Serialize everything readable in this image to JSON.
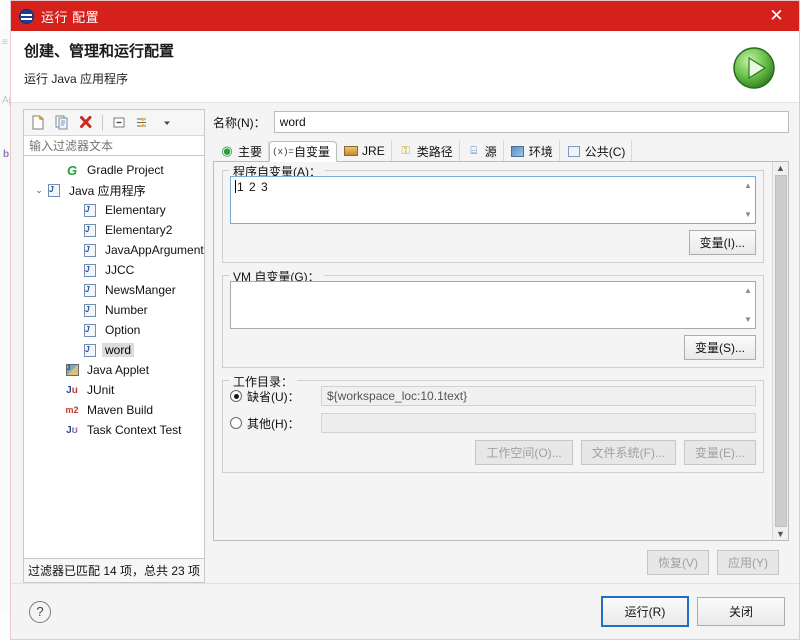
{
  "window": {
    "title": "运行 配置",
    "close_label": "✕",
    "titlebar_color": "#d5211c",
    "icon": "run-config-icon"
  },
  "header": {
    "title": "创建、管理和运行配置",
    "subtitle": "运行 Java 应用程序",
    "badge_icon": "green-run-play-icon",
    "badge_color": "#4caf3f"
  },
  "tree_panel": {
    "toolbar": [
      {
        "name": "new-configuration-button",
        "glyph": "❐"
      },
      {
        "name": "duplicate-configuration-button",
        "glyph": "❑"
      },
      {
        "name": "delete-configuration-button",
        "glyph": "✖"
      },
      {
        "name": "collapse-all-button",
        "glyph": "⊟"
      },
      {
        "name": "filter-button",
        "glyph": "⇶"
      },
      {
        "name": "view-menu-dropdown-button",
        "glyph": "▾"
      }
    ],
    "filter": {
      "placeholder": "输入过滤器文本",
      "value": ""
    },
    "items": [
      {
        "label": "Gradle Project",
        "icon": "gradle-icon",
        "indent": 1,
        "twist": "",
        "selected": false
      },
      {
        "label": "Java 应用程序",
        "icon": "java-icon",
        "indent": 0,
        "twist": "⌄",
        "selected": false
      },
      {
        "label": "Elementary",
        "icon": "java-icon",
        "indent": 2,
        "twist": "",
        "selected": false
      },
      {
        "label": "Elementary2",
        "icon": "java-icon",
        "indent": 2,
        "twist": "",
        "selected": false
      },
      {
        "label": "JavaAppArguments",
        "icon": "java-icon",
        "indent": 2,
        "twist": "",
        "selected": false
      },
      {
        "label": "JJCC",
        "icon": "java-icon",
        "indent": 2,
        "twist": "",
        "selected": false
      },
      {
        "label": "NewsManger",
        "icon": "java-icon",
        "indent": 2,
        "twist": "",
        "selected": false
      },
      {
        "label": "Number",
        "icon": "java-icon",
        "indent": 2,
        "twist": "",
        "selected": false
      },
      {
        "label": "Option",
        "icon": "java-icon",
        "indent": 2,
        "twist": "",
        "selected": false
      },
      {
        "label": "word",
        "icon": "java-icon",
        "indent": 2,
        "twist": "",
        "selected": true
      },
      {
        "label": "Java Applet",
        "icon": "java-applet-icon",
        "indent": 1,
        "twist": "",
        "selected": false
      },
      {
        "label": "JUnit",
        "icon": "junit-icon",
        "indent": 1,
        "twist": "",
        "selected": false
      },
      {
        "label": "Maven Build",
        "icon": "maven-icon",
        "indent": 1,
        "twist": "",
        "selected": false
      },
      {
        "label": "Task Context Test",
        "icon": "task-context-test-icon",
        "indent": 1,
        "twist": "",
        "selected": false
      }
    ],
    "status": "过滤器已匹配 14 项，总共 23 项"
  },
  "config": {
    "name_label": "名称(N)：",
    "name_value": "word",
    "tabs": [
      {
        "label": "主要",
        "icon": "main-green-circle-icon",
        "active": false
      },
      {
        "label": "自变量",
        "icon": "arguments-xeq-icon",
        "active": true
      },
      {
        "label": "JRE",
        "icon": "jre-icon",
        "active": false
      },
      {
        "label": "类路径",
        "icon": "classpath-icon",
        "active": false
      },
      {
        "label": "源",
        "icon": "source-icon",
        "active": false
      },
      {
        "label": "环境",
        "icon": "environment-icon",
        "active": false
      },
      {
        "label": "公共(C)",
        "icon": "common-icon",
        "active": false
      }
    ],
    "program_args": {
      "legend": "程序自变量(A)：",
      "value": "1 2 3",
      "variables_button": "变量(I)..."
    },
    "vm_args": {
      "legend": "VM 自变量(G)：",
      "value": "",
      "variables_button": "变量(S)..."
    },
    "working_dir": {
      "legend": "工作目录：",
      "default_label": "缺省(U)：",
      "default_value": "${workspace_loc:10.1text}",
      "default_selected": true,
      "other_label": "其他(H)：",
      "other_value": "",
      "other_selected": false,
      "workspace_button": "工作空间(O)...",
      "filesystem_button": "文件系统(F)...",
      "variables_button": "变量(E)..."
    }
  },
  "actions": {
    "revert": "恢复(V)",
    "apply": "应用(Y)",
    "run": "运行(R)",
    "close": "关闭",
    "help_icon": "help-question-icon"
  }
}
